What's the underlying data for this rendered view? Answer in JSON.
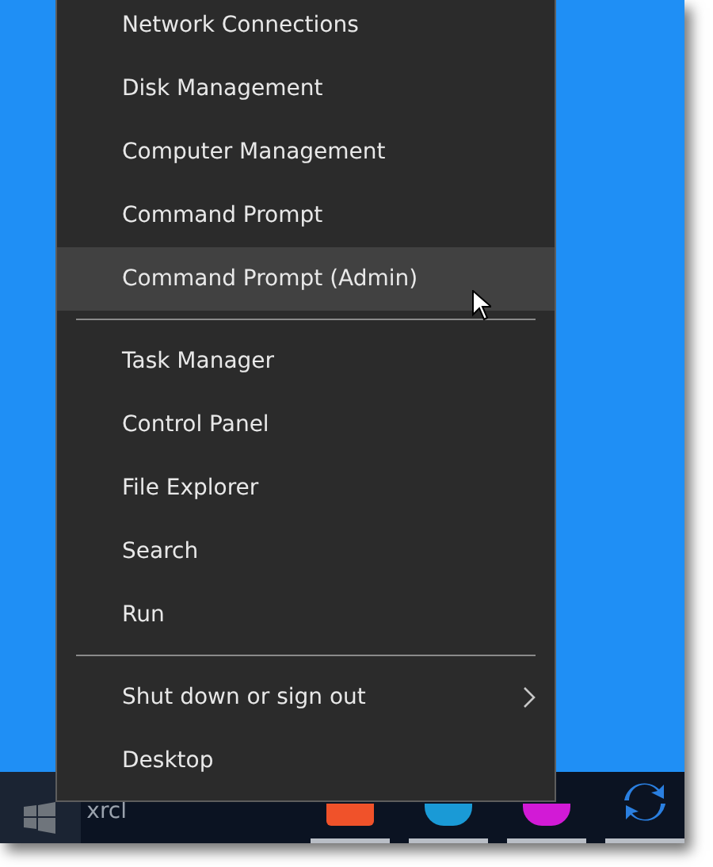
{
  "menu": {
    "groups": [
      {
        "items": [
          {
            "label": "Network Connections",
            "kind": "item",
            "highlighted": false
          },
          {
            "label": "Disk Management",
            "kind": "item",
            "highlighted": false
          },
          {
            "label": "Computer Management",
            "kind": "item",
            "highlighted": false
          },
          {
            "label": "Command Prompt",
            "kind": "item",
            "highlighted": false
          },
          {
            "label": "Command Prompt (Admin)",
            "kind": "item",
            "highlighted": true
          }
        ]
      },
      {
        "items": [
          {
            "label": "Task Manager",
            "kind": "item",
            "highlighted": false
          },
          {
            "label": "Control Panel",
            "kind": "item",
            "highlighted": false
          },
          {
            "label": "File Explorer",
            "kind": "item",
            "highlighted": false
          },
          {
            "label": "Search",
            "kind": "item",
            "highlighted": false
          },
          {
            "label": "Run",
            "kind": "item",
            "highlighted": false
          }
        ]
      },
      {
        "items": [
          {
            "label": "Shut down or sign out",
            "kind": "submenu",
            "highlighted": false
          },
          {
            "label": "Desktop",
            "kind": "item",
            "highlighted": false
          }
        ]
      }
    ]
  },
  "taskbar": {
    "search_text": "xrcl",
    "apps": [
      {
        "color": "#f0522a"
      },
      {
        "color": "#1a9ad6"
      },
      {
        "color": "#d21ad6"
      },
      {
        "color": "#2a7fe0"
      }
    ]
  }
}
